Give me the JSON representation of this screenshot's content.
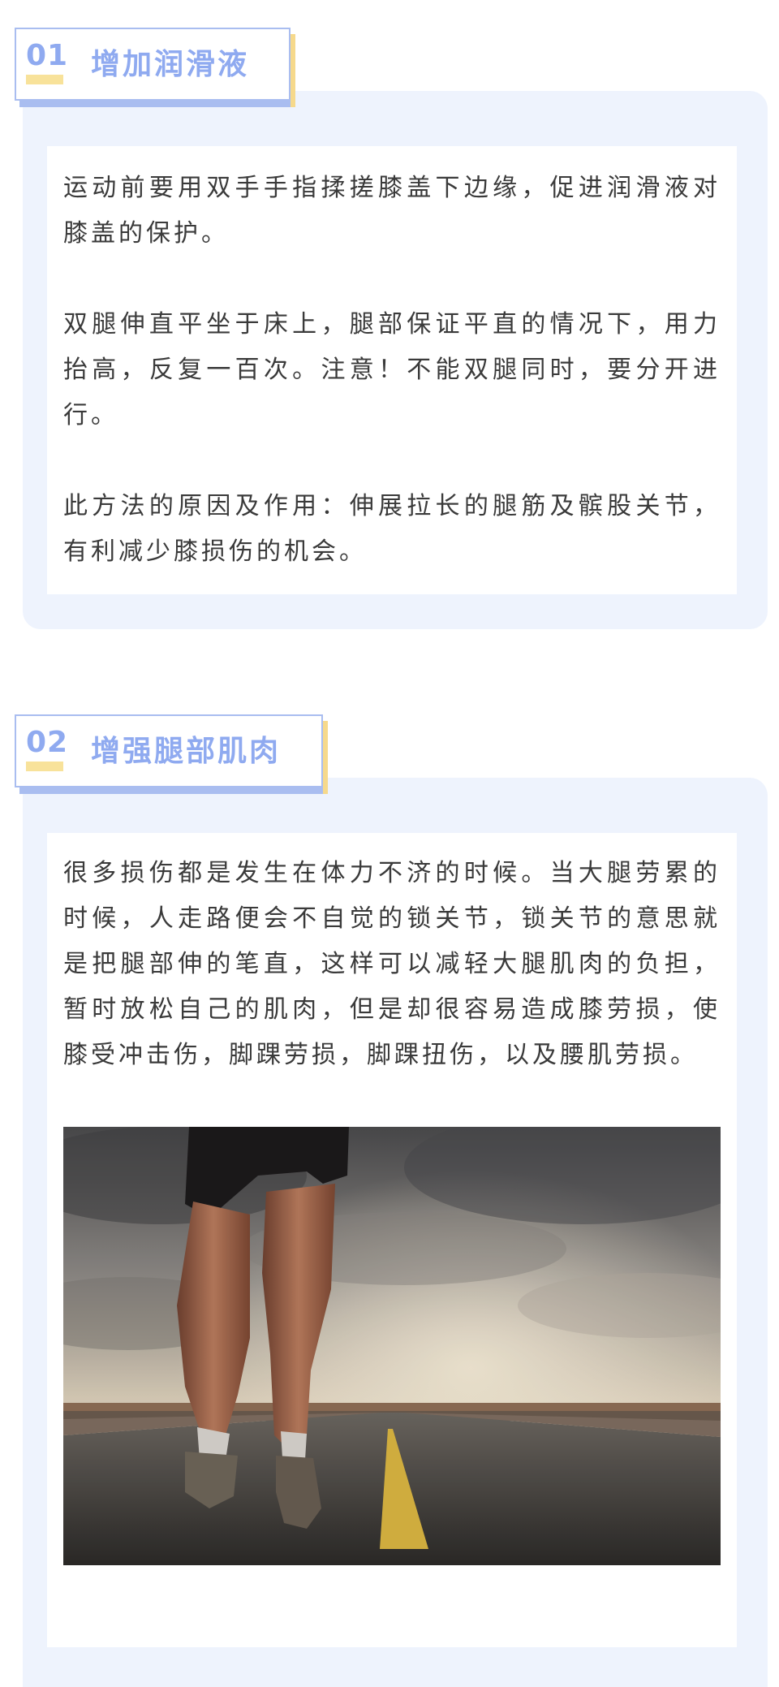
{
  "sections": [
    {
      "number": "01",
      "title": "增加润滑液",
      "paragraphs": [
        "运动前要用双手手指揉搓膝盖下边缘，促进润滑液对膝盖的保护。",
        "双腿伸直平坐于床上，腿部保证平直的情况下，用力抬高，反复一百次。注意！不能双腿同时，要分开进行。",
        "此方法的原因及作用：伸展拉长的腿筋及髌股关节，有利减少膝损伤的机会。"
      ]
    },
    {
      "number": "02",
      "title": "增强腿部肌肉",
      "paragraphs": [
        "很多损伤都是发生在体力不济的时候。当大腿劳累的时候，人走路便会不自觉的锁关节，锁关节的意思就是把腿部伸的笔直，这样可以减轻大腿肌肉的负担，暂时放松自己的肌肉，但是却很容易造成膝劳损，使膝受冲击伤，脚踝劳损，脚踝扭伤，以及腰肌劳损。"
      ],
      "image": {
        "subject": "runner-on-road-photo"
      }
    }
  ],
  "colors": {
    "accent_blue": "#8faaf0",
    "accent_yellow": "#f8e29a",
    "card_background": "#eef3fd",
    "text": "#3a3a3a"
  }
}
